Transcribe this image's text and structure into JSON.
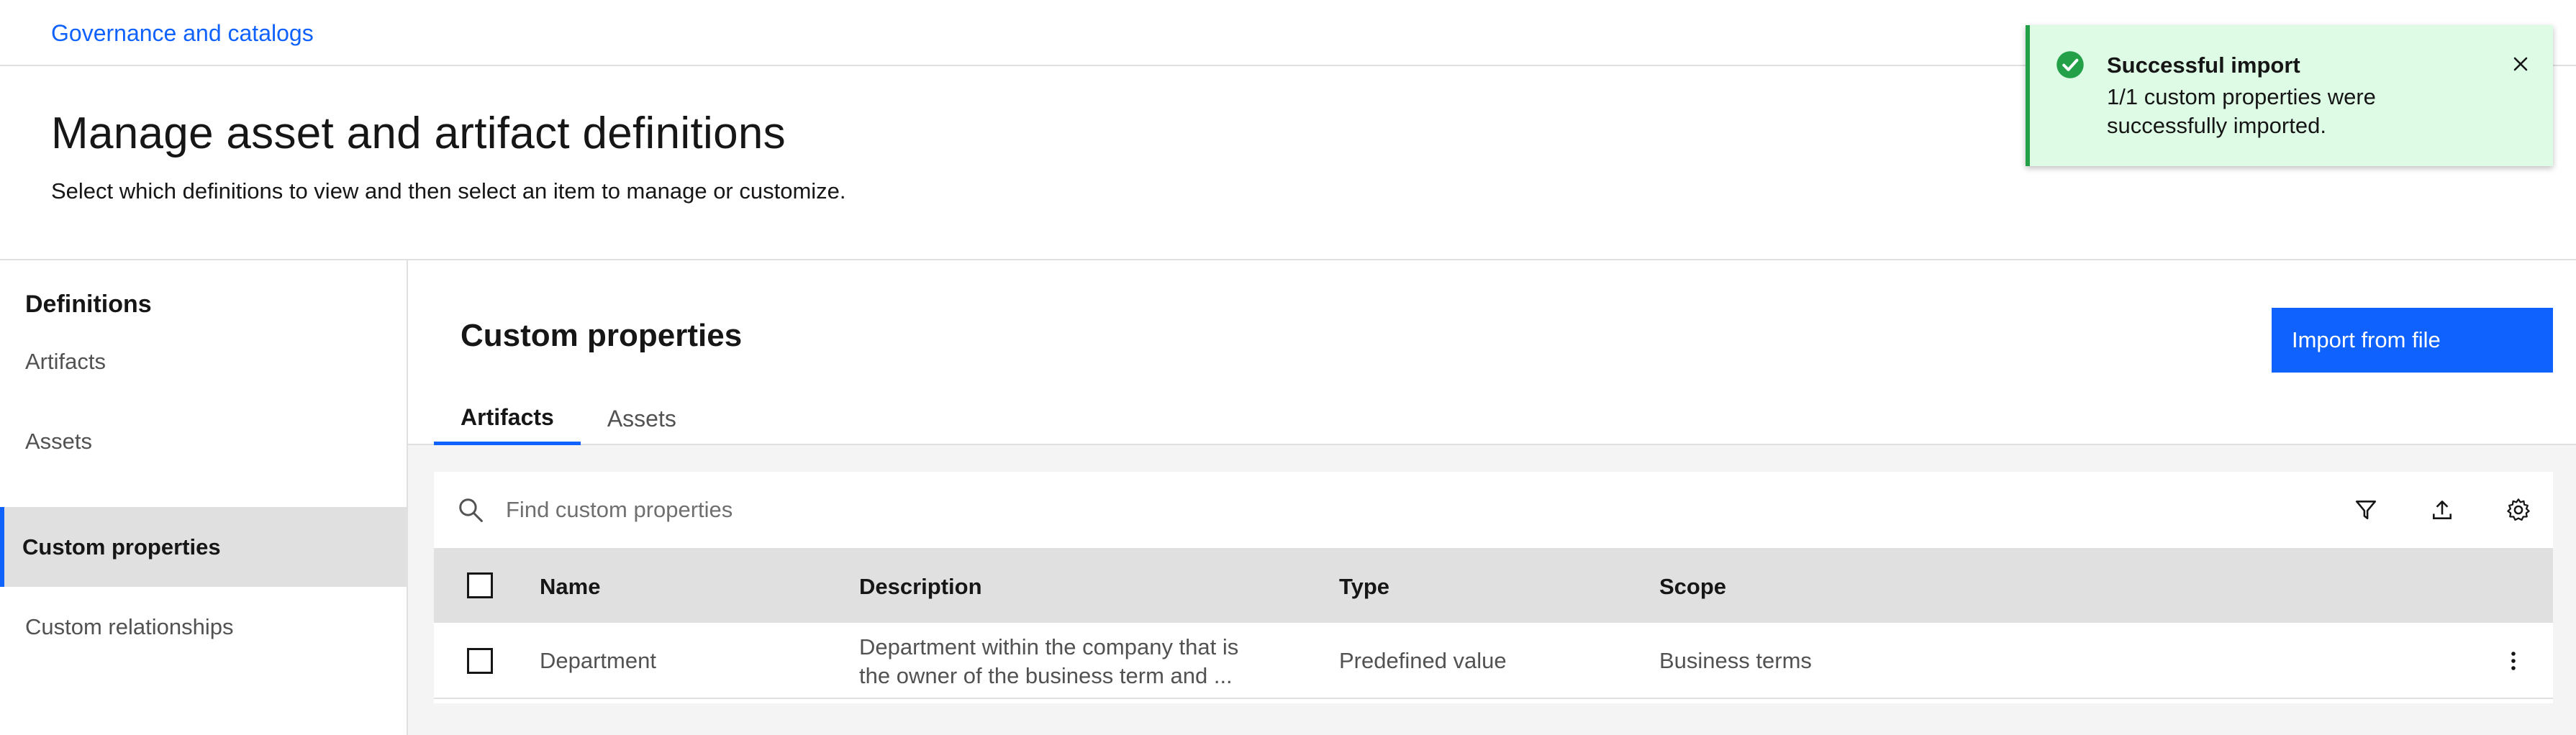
{
  "breadcrumb": {
    "link": "Governance and catalogs"
  },
  "page": {
    "title": "Manage asset and artifact definitions",
    "subtitle": "Select which definitions to view and then select an item to manage or customize."
  },
  "sidebar": {
    "heading": "Definitions",
    "items": [
      {
        "label": "Artifacts",
        "active": false
      },
      {
        "label": "Assets",
        "active": false
      },
      {
        "label": "Custom properties",
        "active": true
      },
      {
        "label": "Custom relationships",
        "active": false
      }
    ]
  },
  "main": {
    "title": "Custom properties",
    "import_button": "Import from file",
    "tabs": [
      {
        "label": "Artifacts",
        "active": true
      },
      {
        "label": "Assets",
        "active": false
      }
    ],
    "search": {
      "placeholder": "Find custom properties",
      "value": ""
    },
    "toolbar_icons": [
      "filter-icon",
      "export-icon",
      "settings-icon"
    ],
    "table": {
      "columns": [
        "Name",
        "Description",
        "Type",
        "Scope"
      ],
      "rows": [
        {
          "name": "Department",
          "description_line1": "Department within the company that is",
          "description_line2": "the owner of the business term and ...",
          "type": "Predefined value",
          "scope": "Business terms"
        }
      ]
    }
  },
  "toast": {
    "title": "Successful import",
    "body": "1/1 custom properties were successfully imported.",
    "status_color": "#24a148",
    "icon": "checkmark-filled-icon"
  },
  "colors": {
    "accent": "#0f62fe",
    "success": "#24a148",
    "success_bg": "#defbe6"
  }
}
